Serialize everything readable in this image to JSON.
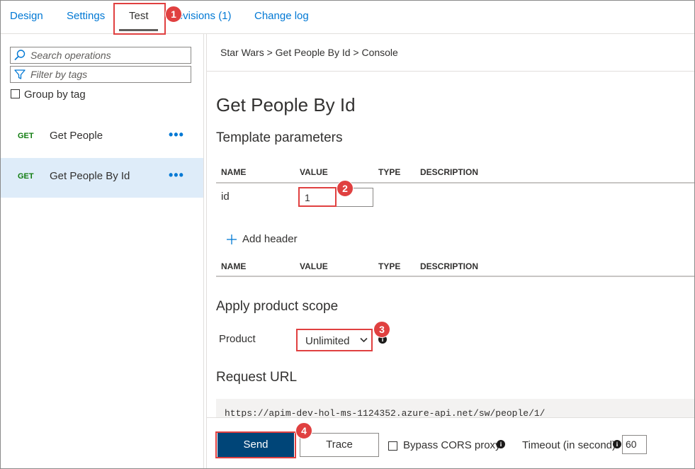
{
  "tabs": [
    {
      "label": "Design"
    },
    {
      "label": "Settings"
    },
    {
      "label": "Test"
    },
    {
      "label": "Revisions (1)"
    },
    {
      "label": "Change log"
    }
  ],
  "sidebar": {
    "search_placeholder": "Search operations",
    "filter_placeholder": "Filter by tags",
    "group_by_tag_label": "Group by tag",
    "operations": [
      {
        "verb": "GET",
        "name": "Get People",
        "more": "•••"
      },
      {
        "verb": "GET",
        "name": "Get People By Id",
        "more": "•••"
      }
    ]
  },
  "main": {
    "breadcrumb": "Star Wars  >  Get People By Id  >  Console",
    "title": "Get People By Id",
    "template_params_heading": "Template parameters",
    "columns": {
      "name": "NAME",
      "value": "VALUE",
      "type": "TYPE",
      "description": "DESCRIPTION"
    },
    "template_param": {
      "name": "id",
      "value": "1"
    },
    "add_header_label": "Add header",
    "product_scope_heading": "Apply product scope",
    "product_label": "Product",
    "product_value": "Unlimited",
    "request_url_heading": "Request URL",
    "request_url": "https://apim-dev-hol-ms-1124352.azure-api.net/sw/people/1/"
  },
  "footer": {
    "send_label": "Send",
    "trace_label": "Trace",
    "bypass_cors_label": "Bypass CORS proxy",
    "timeout_label": "Timeout (in second)",
    "timeout_value": "60"
  },
  "callouts": [
    "1",
    "2",
    "3",
    "4"
  ],
  "colors": {
    "accent": "#0078d4",
    "send": "#004578",
    "callout": "#e04040",
    "selected_row": "#deecf9",
    "get_verb": "#107c10"
  }
}
